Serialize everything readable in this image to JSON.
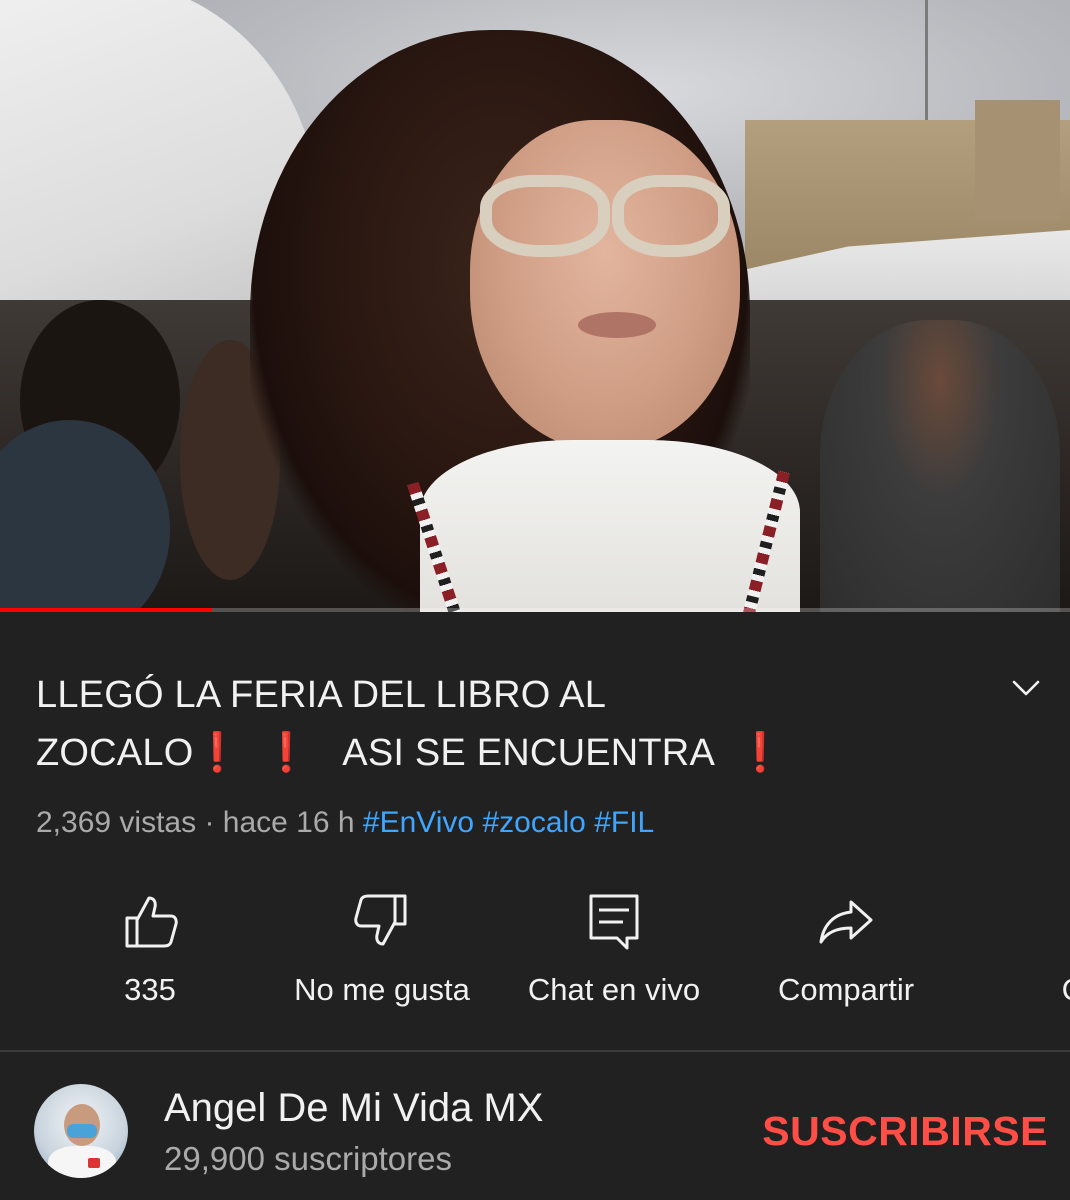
{
  "video": {
    "progress_fraction": 0.198,
    "progress_color": "#ff0000"
  },
  "title": {
    "part1": "LLEGÓ LA FERIA DEL LIBRO AL",
    "part2": "ZOCALO",
    "mark1": "❗",
    "mark2": "❗",
    "part3": "ASI SE ENCUENTRA",
    "mark3": "❗",
    "expand_icon": "chevron-down-icon"
  },
  "meta": {
    "views": "2,369 vistas",
    "separator": "·",
    "time": "hace 16 h",
    "hashtags": [
      "#EnVivo",
      "#zocalo",
      "#FIL"
    ],
    "hashtag_color": "#3ea6ff"
  },
  "actions": [
    {
      "icon": "thumbs-up-icon",
      "label": "335"
    },
    {
      "icon": "thumbs-down-icon",
      "label": "No me gusta"
    },
    {
      "icon": "live-chat-icon",
      "label": "Chat en vivo"
    },
    {
      "icon": "share-icon",
      "label": "Compartir"
    },
    {
      "icon": "create-clip-icon",
      "label": "Cr"
    }
  ],
  "channel": {
    "name": "Angel De Mi Vida MX",
    "subscribers": "29,900 suscriptores",
    "subscribe_label": "SUSCRIBIRSE",
    "subscribe_color": "#ff4e45"
  }
}
